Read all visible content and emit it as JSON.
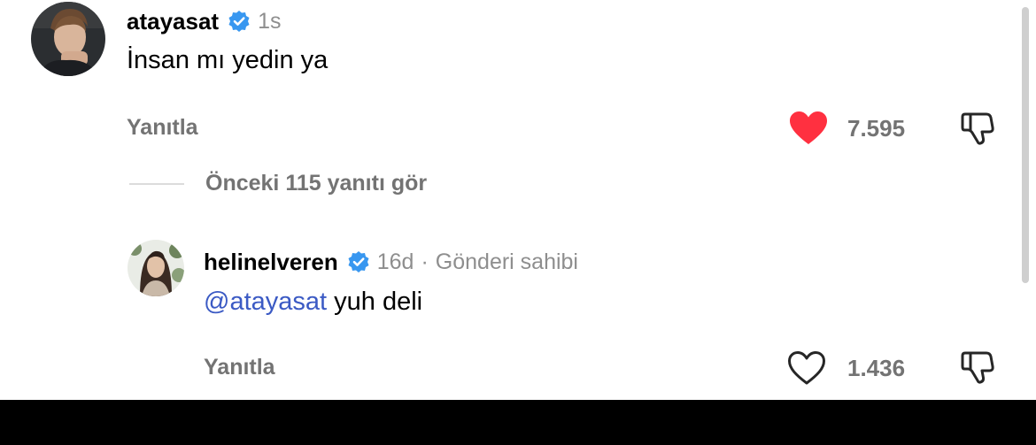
{
  "comments": [
    {
      "username": "atayasat",
      "verified": true,
      "time": "1s",
      "text": "İnsan mı yedin ya",
      "reply_label": "Yanıtla",
      "like_count": "7.595",
      "liked": true
    }
  ],
  "view_previous": {
    "label": "Önceki 115 yanıtı gör"
  },
  "replies": [
    {
      "username": "helinelveren",
      "verified": true,
      "time": "16d",
      "separator": "·",
      "badge": "Gönderi sahibi",
      "mention": "@atayasat",
      "text": " yuh deli",
      "reply_label": "Yanıtla",
      "like_count": "1.436",
      "liked": false
    }
  ],
  "icons": {
    "verified": "verified-badge-icon",
    "like_filled": "heart-filled-icon",
    "like_outline": "heart-outline-icon",
    "dislike": "thumbs-down-icon"
  },
  "colors": {
    "verified": "#3897f0",
    "liked_heart": "#ff3040",
    "mention": "#3b5ac4",
    "secondary_text": "#737373"
  }
}
